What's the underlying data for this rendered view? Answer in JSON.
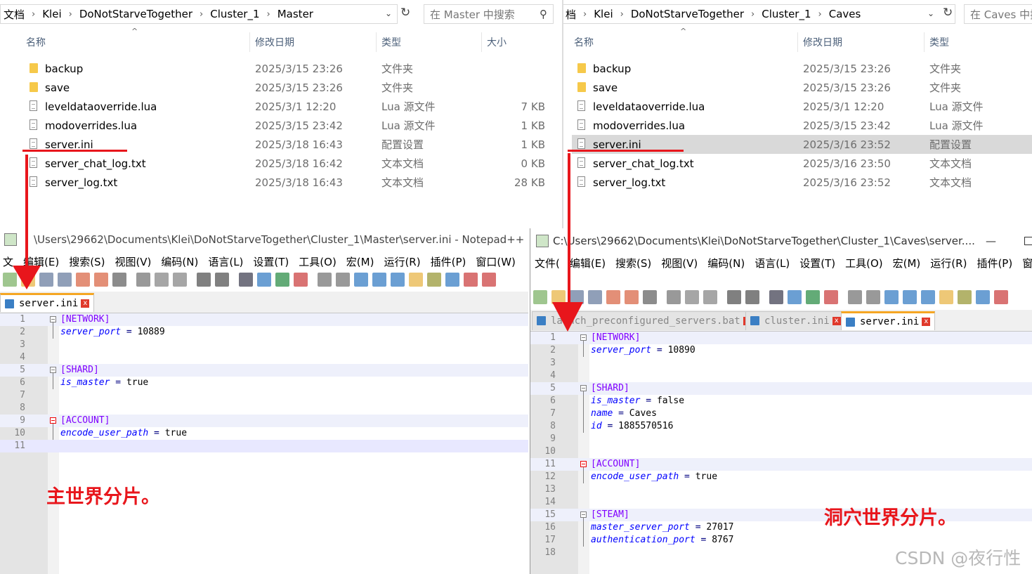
{
  "left_explorer": {
    "breadcrumb": [
      "文档",
      "Klei",
      "DoNotStarveTogether",
      "Cluster_1",
      "Master"
    ],
    "search_placeholder": "在 Master 中搜索",
    "columns": {
      "name": "名称",
      "date": "修改日期",
      "type": "类型",
      "size": "大小"
    },
    "files": [
      {
        "name": "backup",
        "date": "2025/3/15 23:26",
        "type": "文件夹",
        "size": "",
        "icon": "folder-icon"
      },
      {
        "name": "save",
        "date": "2025/3/15 23:26",
        "type": "文件夹",
        "size": "",
        "icon": "folder-icon"
      },
      {
        "name": "leveldataoverride.lua",
        "date": "2025/3/1 12:20",
        "type": "Lua 源文件",
        "size": "7 KB",
        "icon": "file-icon"
      },
      {
        "name": "modoverrides.lua",
        "date": "2025/3/15 23:42",
        "type": "Lua 源文件",
        "size": "1 KB",
        "icon": "file-icon"
      },
      {
        "name": "server.ini",
        "date": "2025/3/18 16:43",
        "type": "配置设置",
        "size": "1 KB",
        "icon": "settings-file-icon"
      },
      {
        "name": "server_chat_log.txt",
        "date": "2025/3/18 16:42",
        "type": "文本文档",
        "size": "0 KB",
        "icon": "file-icon"
      },
      {
        "name": "server_log.txt",
        "date": "2025/3/18 16:43",
        "type": "文本文档",
        "size": "28 KB",
        "icon": "file-icon"
      }
    ]
  },
  "right_explorer": {
    "breadcrumb": [
      "档",
      "Klei",
      "DoNotStarveTogether",
      "Cluster_1",
      "Caves"
    ],
    "search_placeholder": "在 Caves 中搜",
    "columns": {
      "name": "名称",
      "date": "修改日期",
      "type": "类型"
    },
    "files": [
      {
        "name": "backup",
        "date": "2025/3/15 23:26",
        "type": "文件夹",
        "icon": "folder-icon"
      },
      {
        "name": "save",
        "date": "2025/3/15 23:26",
        "type": "文件夹",
        "icon": "folder-icon"
      },
      {
        "name": "leveldataoverride.lua",
        "date": "2025/3/1 12:20",
        "type": "Lua 源文件",
        "icon": "file-icon"
      },
      {
        "name": "modoverrides.lua",
        "date": "2025/3/15 23:42",
        "type": "Lua 源文件",
        "icon": "file-icon"
      },
      {
        "name": "server.ini",
        "date": "2025/3/16 23:52",
        "type": "配置设置",
        "icon": "settings-file-icon",
        "selected": true
      },
      {
        "name": "server_chat_log.txt",
        "date": "2025/3/16 23:50",
        "type": "文本文档",
        "icon": "file-icon"
      },
      {
        "name": "server_log.txt",
        "date": "2025/3/16 23:52",
        "type": "文本文档",
        "icon": "file-icon"
      }
    ]
  },
  "left_notepad": {
    "title": "\\Users\\29662\\Documents\\Klei\\DoNotStarveTogether\\Cluster_1\\Master\\server.ini - Notepad++",
    "menu": [
      "文",
      "编辑(E)",
      "搜索(S)",
      "视图(V)",
      "编码(N)",
      "语言(L)",
      "设置(T)",
      "工具(O)",
      "宏(M)",
      "运行(R)",
      "插件(P)",
      "窗口(W)"
    ],
    "tabs": [
      {
        "label": "server.ini",
        "active": true
      }
    ],
    "lines": [
      {
        "n": "1",
        "section": "[NETWORK]"
      },
      {
        "n": "2",
        "key": "server_port",
        "value": "10889"
      },
      {
        "n": "3"
      },
      {
        "n": "4"
      },
      {
        "n": "5",
        "section": "[SHARD]"
      },
      {
        "n": "6",
        "key": "is_master",
        "value": "true"
      },
      {
        "n": "7"
      },
      {
        "n": "8"
      },
      {
        "n": "9",
        "section": "[ACCOUNT]"
      },
      {
        "n": "10",
        "key": "encode_user_path",
        "value": "true"
      },
      {
        "n": "11"
      }
    ],
    "annotation": "主世界分片。"
  },
  "right_notepad": {
    "title": "C:\\Users\\29662\\Documents\\Klei\\DoNotStarveTogether\\Cluster_1\\Caves\\server....",
    "menu": [
      "文件(",
      "编辑(E)",
      "搜索(S)",
      "视图(V)",
      "编码(N)",
      "语言(L)",
      "设置(T)",
      "工具(O)",
      "宏(M)",
      "运行(R)",
      "插件(P)",
      "窗"
    ],
    "tabs": [
      {
        "label": "launch_preconfigured_servers.bat",
        "active": false
      },
      {
        "label": "cluster.ini",
        "active": false
      },
      {
        "label": "server.ini",
        "active": true
      }
    ],
    "lines": [
      {
        "n": "1",
        "section": "[NETWORK]"
      },
      {
        "n": "2",
        "key": "server_port",
        "value": "10890"
      },
      {
        "n": "3"
      },
      {
        "n": "4"
      },
      {
        "n": "5",
        "section": "[SHARD]"
      },
      {
        "n": "6",
        "key": "is_master",
        "value": "false"
      },
      {
        "n": "7",
        "key": "name",
        "value": "Caves"
      },
      {
        "n": "8",
        "key": "id",
        "value": "1885570516"
      },
      {
        "n": "9"
      },
      {
        "n": "10"
      },
      {
        "n": "11",
        "section": "[ACCOUNT]"
      },
      {
        "n": "12",
        "key": "encode_user_path",
        "value": "true"
      },
      {
        "n": "13"
      },
      {
        "n": "14"
      },
      {
        "n": "15",
        "section": "[STEAM]"
      },
      {
        "n": "16",
        "key": "master_server_port",
        "value": "27017"
      },
      {
        "n": "17",
        "key": "authentication_port",
        "value": "8767"
      },
      {
        "n": "18"
      }
    ],
    "annotation": "洞穴世界分片。"
  },
  "watermark": "CSDN @夜行性",
  "colors": {
    "annotation_red": "#e8161c",
    "section": "#8000ff",
    "key": "#0000ff",
    "tab_accent": "#f5a623"
  }
}
